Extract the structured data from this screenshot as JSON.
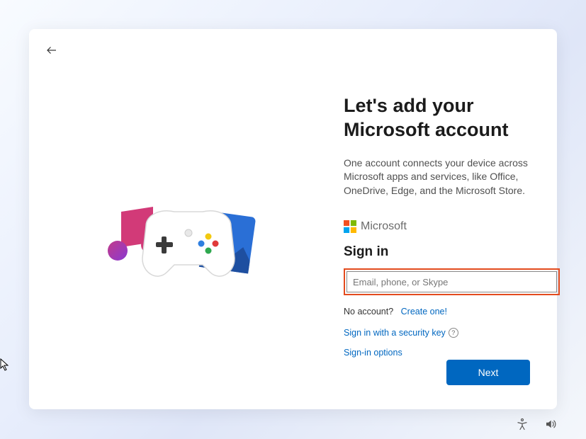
{
  "page": {
    "title": "Let's add your Microsoft account",
    "description": "One account connects your device across Microsoft apps and services, like Office, OneDrive, Edge, and the Microsoft Store."
  },
  "brand": {
    "name": "Microsoft"
  },
  "signin": {
    "heading": "Sign in",
    "email_placeholder": "Email, phone, or Skype",
    "email_value": "",
    "no_account_text": "No account?",
    "create_one_label": "Create one!",
    "security_key_label": "Sign in with a security key",
    "options_label": "Sign-in options"
  },
  "actions": {
    "next_label": "Next"
  },
  "icons": {
    "back": "back-arrow",
    "accessibility": "accessibility",
    "volume": "volume"
  },
  "colors": {
    "accent": "#0067c0",
    "highlight": "#e34b1e"
  }
}
